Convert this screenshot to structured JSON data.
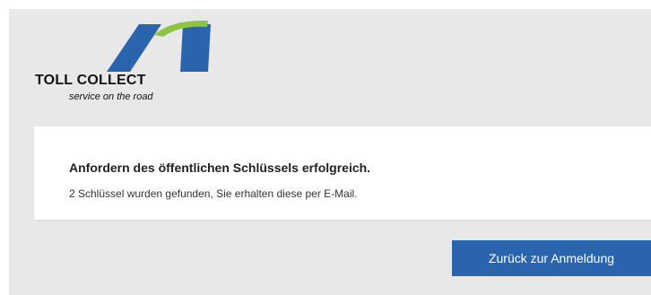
{
  "logo": {
    "name": "TOLL COLLECT",
    "tagline": "service on the road",
    "colors": {
      "blue": "#2a64ad",
      "green": "#8cc63f"
    }
  },
  "message": {
    "title": "Anfordern des öffentlichen Schlüssels erfolgreich.",
    "text": "2 Schlüssel wurden gefunden, Sie erhalten diese per E-Mail."
  },
  "actions": {
    "back_label": "Zurück zur Anmeldung"
  },
  "colors": {
    "background": "#e8e8e8",
    "card": "#ffffff",
    "button": "#2a64ad",
    "button_text": "#ffffff"
  }
}
